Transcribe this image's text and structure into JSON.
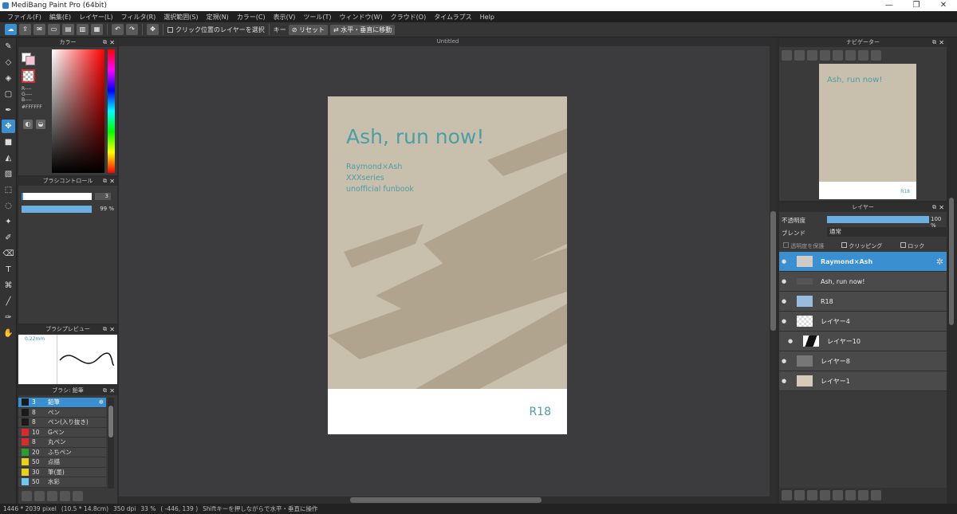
{
  "window": {
    "title": "MediBang Paint Pro (64bit)",
    "controls": [
      "—",
      "❐",
      "✕"
    ]
  },
  "menu": [
    "ファイル(F)",
    "編集(E)",
    "レイヤー(L)",
    "フィルタ(R)",
    "選択範囲(S)",
    "定規(N)",
    "カラー(C)",
    "表示(V)",
    "ツール(T)",
    "ウィンドウ(W)",
    "クラウド(O)",
    "タイムラプス",
    "Help"
  ],
  "toolbar": {
    "select_layer_label": "クリック位置のレイヤーを選択",
    "key_label": "キー",
    "reset_label": "リセット",
    "flip_label": "水平・垂直に移動"
  },
  "color_panel": {
    "title": "カラー",
    "r": "R----",
    "g": "G----",
    "b": "B----",
    "hex": "#FFFFFF",
    "accent": "#3a8fd0"
  },
  "brush_control": {
    "title": "ブラシコントロール",
    "size": "3",
    "opacity": "99 %"
  },
  "brush_preview": {
    "title": "ブラシプレビュー",
    "size_label": "0.22mm"
  },
  "brush_list": {
    "title": "ブラシ: 鉛筆",
    "items": [
      {
        "size": "3",
        "name": "鉛筆",
        "color": "#1a1a1a",
        "selected": true
      },
      {
        "size": "8",
        "name": "ペン",
        "color": "#1a1a1a"
      },
      {
        "size": "8",
        "name": "ペン(入り抜き)",
        "color": "#1a1a1a"
      },
      {
        "size": "10",
        "name": "Gペン",
        "color": "#d92b2b"
      },
      {
        "size": "8",
        "name": "丸ペン",
        "color": "#d92b2b"
      },
      {
        "size": "20",
        "name": "ふちペン",
        "color": "#29a02e"
      },
      {
        "size": "50",
        "name": "点描",
        "color": "#e8d21c"
      },
      {
        "size": "30",
        "name": "筆(墨)",
        "color": "#e8d21c"
      },
      {
        "size": "50",
        "name": "水彩",
        "color": "#6fc8f0"
      }
    ]
  },
  "canvas": {
    "tab": "Untitled",
    "title": "Ash, run now!",
    "subtitle_lines": [
      "Raymond×Ash",
      "XXXseries",
      "unofficial funbook"
    ],
    "rating": "R18"
  },
  "navigator": {
    "title": "ナビゲーター"
  },
  "layers_panel": {
    "title": "レイヤー",
    "opacity_label": "不透明度",
    "opacity_value": "100 %",
    "blend_label": "ブレンド",
    "blend_value": "通常",
    "protect_label": "透明度を保護",
    "clip_label": "クリッピング",
    "lock_label": "ロック",
    "layers": [
      {
        "name": "Raymond×Ash",
        "selected": true
      },
      {
        "name": "Ash, run now!"
      },
      {
        "name": "R18"
      },
      {
        "name": "レイヤー4"
      },
      {
        "name": "レイヤー10"
      },
      {
        "name": "レイヤー8"
      },
      {
        "name": "レイヤー1"
      }
    ]
  },
  "status": {
    "dims": "1446 * 2039 pixel",
    "physical": "(10.5 * 14.8cm)",
    "dpi": "350 dpi",
    "zoom": "33 %",
    "coords": "( -446, 139 )",
    "hint": "Shiftキーを押しながらで水平・垂直に操作"
  }
}
